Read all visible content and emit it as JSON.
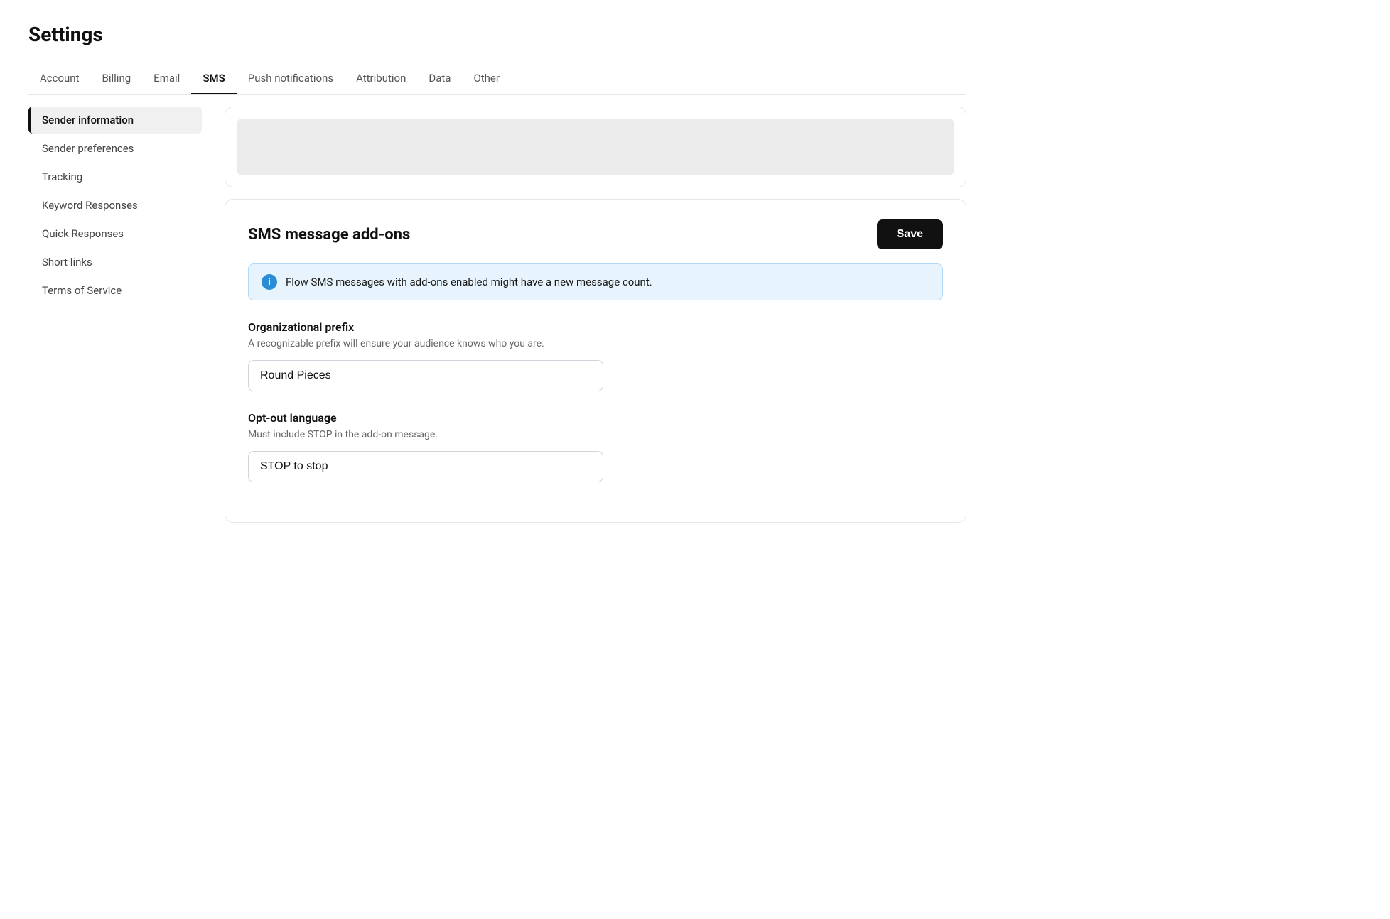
{
  "page": {
    "title": "Settings"
  },
  "topNav": {
    "items": [
      {
        "id": "account",
        "label": "Account",
        "active": false
      },
      {
        "id": "billing",
        "label": "Billing",
        "active": false
      },
      {
        "id": "email",
        "label": "Email",
        "active": false
      },
      {
        "id": "sms",
        "label": "SMS",
        "active": true
      },
      {
        "id": "push-notifications",
        "label": "Push notifications",
        "active": false
      },
      {
        "id": "attribution",
        "label": "Attribution",
        "active": false
      },
      {
        "id": "data",
        "label": "Data",
        "active": false
      },
      {
        "id": "other",
        "label": "Other",
        "active": false
      }
    ]
  },
  "sidebar": {
    "items": [
      {
        "id": "sender-information",
        "label": "Sender information",
        "active": true
      },
      {
        "id": "sender-preferences",
        "label": "Sender preferences",
        "active": false
      },
      {
        "id": "tracking",
        "label": "Tracking",
        "active": false
      },
      {
        "id": "keyword-responses",
        "label": "Keyword Responses",
        "active": false
      },
      {
        "id": "quick-responses",
        "label": "Quick Responses",
        "active": false
      },
      {
        "id": "short-links",
        "label": "Short links",
        "active": false
      },
      {
        "id": "terms-of-service",
        "label": "Terms of Service",
        "active": false
      }
    ]
  },
  "addonsCard": {
    "title": "SMS message add-ons",
    "saveButton": "Save",
    "infoBanner": {
      "text": "Flow SMS messages with add-ons enabled might have a new message count."
    },
    "orgPrefix": {
      "title": "Organizational prefix",
      "description": "A recognizable prefix will ensure your audience knows who you are.",
      "value": "Round Pieces",
      "placeholder": ""
    },
    "optOutLanguage": {
      "title": "Opt-out language",
      "description": "Must include STOP in the add-on message.",
      "value": "STOP to stop",
      "placeholder": ""
    }
  }
}
